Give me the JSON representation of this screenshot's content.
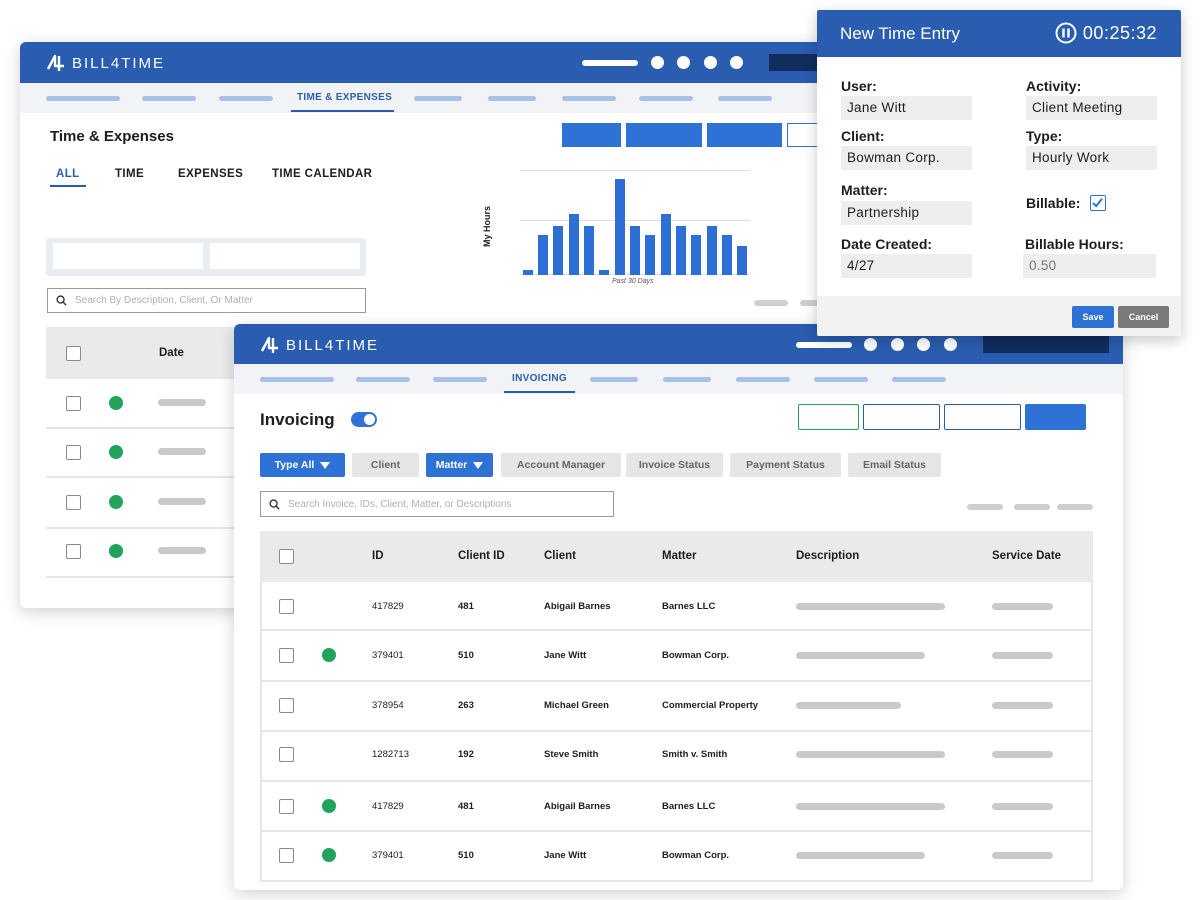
{
  "brand": {
    "name": "BILL4TIME"
  },
  "time_expenses": {
    "nav_active": "TIME & EXPENSES",
    "title": "Time & Expenses",
    "tabs": [
      {
        "label": "ALL",
        "active": true
      },
      {
        "label": "TIME",
        "active": false
      },
      {
        "label": "EXPENSES",
        "active": false
      },
      {
        "label": "TIME CALENDAR",
        "active": false
      }
    ],
    "search_placeholder": "Search By Description, Client, Or Matter",
    "table": {
      "header_date": "Date"
    },
    "chart_data": {
      "type": "bar",
      "ylabel": "My Hours",
      "xlabel": "Past 30 Days",
      "values": [
        0.5,
        3.8,
        4.7,
        5.9,
        4.7,
        0.5,
        9.2,
        4.7,
        3.8,
        5.9,
        4.7,
        3.8,
        4.7,
        3.8,
        2.8
      ],
      "ylim": [
        0,
        10
      ],
      "grid": true
    }
  },
  "invoicing": {
    "nav_active": "INVOICING",
    "title": "Invoicing",
    "toggle_on": true,
    "filters": [
      {
        "label": "Type All",
        "style": "blue",
        "dropdown": true
      },
      {
        "label": "Client",
        "style": "grey",
        "dropdown": false
      },
      {
        "label": "Matter",
        "style": "blue",
        "dropdown": true
      },
      {
        "label": "Account Manager",
        "style": "grey",
        "dropdown": false
      },
      {
        "label": "Invoice Status",
        "style": "grey",
        "dropdown": false
      },
      {
        "label": "Payment Status",
        "style": "grey",
        "dropdown": false
      },
      {
        "label": "Email Status",
        "style": "grey",
        "dropdown": false
      }
    ],
    "search_placeholder": "Search Invoice, IDs, Client, Matter, or Descriptions",
    "columns": [
      "ID",
      "Client ID",
      "Client",
      "Matter",
      "Description",
      "Service Date"
    ],
    "rows": [
      {
        "id": "417829",
        "client_id": "481",
        "client": "Abigail Barnes",
        "matter": "Barnes LLC",
        "status_dot": false
      },
      {
        "id": "379401",
        "client_id": "510",
        "client": "Jane Witt",
        "matter": "Bowman Corp.",
        "status_dot": true
      },
      {
        "id": "378954",
        "client_id": "263",
        "client": "Michael Green",
        "matter": "Commercial Property",
        "status_dot": false
      },
      {
        "id": "1282713",
        "client_id": "192",
        "client": "Steve Smith",
        "matter": "Smith v. Smith",
        "status_dot": false
      },
      {
        "id": "417829",
        "client_id": "481",
        "client": "Abigail Barnes",
        "matter": "Barnes LLC",
        "status_dot": true
      },
      {
        "id": "379401",
        "client_id": "510",
        "client": "Jane Witt",
        "matter": "Bowman Corp.",
        "status_dot": true
      }
    ]
  },
  "time_entry": {
    "title": "New Time Entry",
    "timer": "00:25:32",
    "fields": {
      "user_label": "User:",
      "user": "Jane Witt",
      "activity_label": "Activity:",
      "activity": "Client Meeting",
      "client_label": "Client:",
      "client": "Bowman Corp.",
      "type_label": "Type:",
      "type": "Hourly Work",
      "matter_label": "Matter:",
      "matter": "Partnership",
      "billable_label": "Billable:",
      "billable": true,
      "date_label": "Date Created:",
      "date": "4/27",
      "hours_label": "Billable Hours:",
      "hours": "0.50"
    },
    "save_label": "Save",
    "cancel_label": "Cancel"
  },
  "colors": {
    "header_blue": "#2a5db0",
    "accent_blue": "#2e72d6",
    "status_green": "#21a35c",
    "nav_placeholder": "#a9c1e6"
  }
}
